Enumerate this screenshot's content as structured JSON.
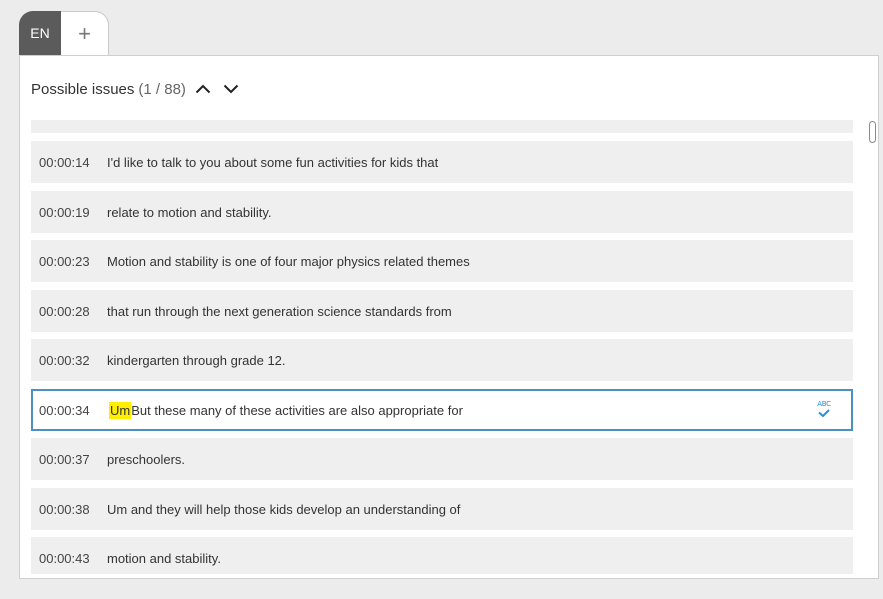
{
  "tabs": {
    "language_label": "EN",
    "add_label": "+"
  },
  "header": {
    "title": "Possible issues",
    "count": "(1 / 88)"
  },
  "rows": [
    {
      "time": "00:00:14",
      "text": "I'd like to talk to you about some fun activities for kids that"
    },
    {
      "time": "00:00:19",
      "text": "relate to motion and stability."
    },
    {
      "time": "00:00:23",
      "text": "Motion and stability is one of four major physics related themes"
    },
    {
      "time": "00:00:28",
      "text": "that run through the next generation science standards from"
    },
    {
      "time": "00:00:32",
      "text": "kindergarten through grade 12."
    },
    {
      "time": "00:00:34",
      "highlight": "Um",
      "text": "But these many of these activities are also appropriate for",
      "spellcheck_label": "ABC"
    },
    {
      "time": "00:00:37",
      "text": "preschoolers."
    },
    {
      "time": "00:00:38",
      "text": "Um and they will help those kids develop an understanding of"
    },
    {
      "time": "00:00:43",
      "text": "motion and stability."
    }
  ],
  "colors": {
    "highlight": "#ffee00",
    "active_border": "#4a90c2",
    "tab_active_bg": "#5b5b5b",
    "row_bg": "#efefef"
  }
}
